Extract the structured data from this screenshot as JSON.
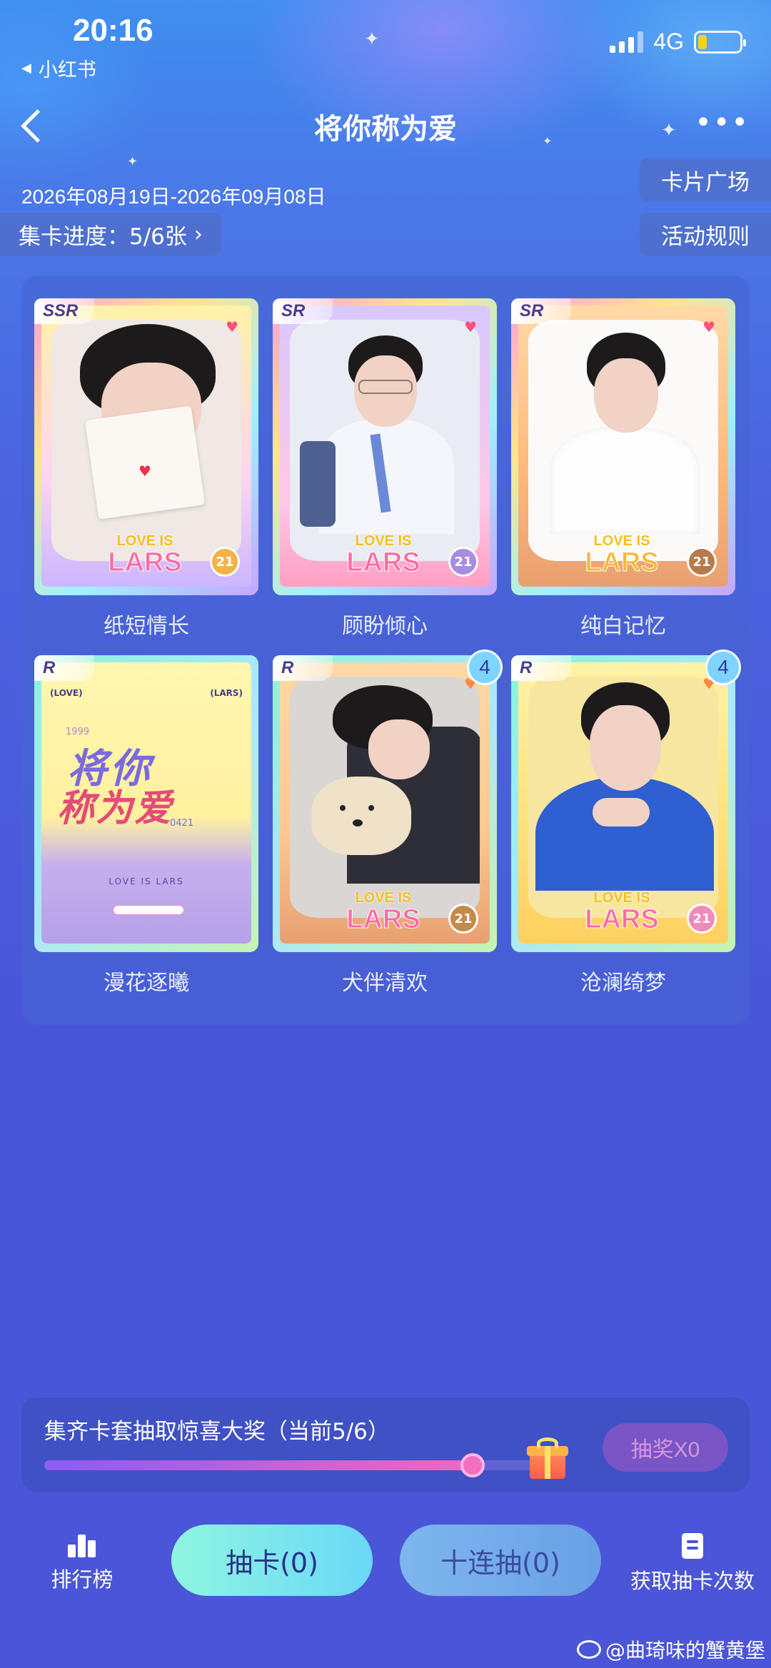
{
  "status_bar": {
    "time": "20:16",
    "back_app": "小红书",
    "network": "4G"
  },
  "header": {
    "title": "将你称为爱"
  },
  "event": {
    "date_range": "2026年08月19日-2026年09月08日",
    "progress_label": "集卡进度：5/6张",
    "plaza_button": "卡片广场",
    "rules_button": "活动规则"
  },
  "cards": [
    {
      "name": "纸短情长",
      "rarity": "SSR",
      "count": ""
    },
    {
      "name": "顾盼倾心",
      "rarity": "SR",
      "count": ""
    },
    {
      "name": "纯白记忆",
      "rarity": "SR",
      "count": ""
    },
    {
      "name": "漫花逐曦",
      "rarity": "R",
      "count": ""
    },
    {
      "name": "犬伴清欢",
      "rarity": "R",
      "count": "4"
    },
    {
      "name": "沧澜绮梦",
      "rarity": "R",
      "count": "4"
    }
  ],
  "card_brand": {
    "line1": "LOVE IS",
    "line2": "LARS",
    "badge": "21"
  },
  "title_card": {
    "line1": "将你",
    "line2": "称为爱",
    "tag_left": "(LOVE)",
    "tag_right": "(LARS)",
    "year": "1999",
    "date": "0421",
    "footer": "LOVE   IS   LARS"
  },
  "lottery": {
    "text": "集齐卡套抽取惊喜大奖（当前5/6）",
    "progress": 0.833,
    "draw_button": "抽奖X0"
  },
  "bottom_nav": {
    "rank_label": "排行榜",
    "pull_one": "抽卡(0)",
    "pull_ten": "十连抽(0)",
    "get_chances": "获取抽卡次数"
  },
  "watermark": "@曲琦味的蟹黄堡"
}
